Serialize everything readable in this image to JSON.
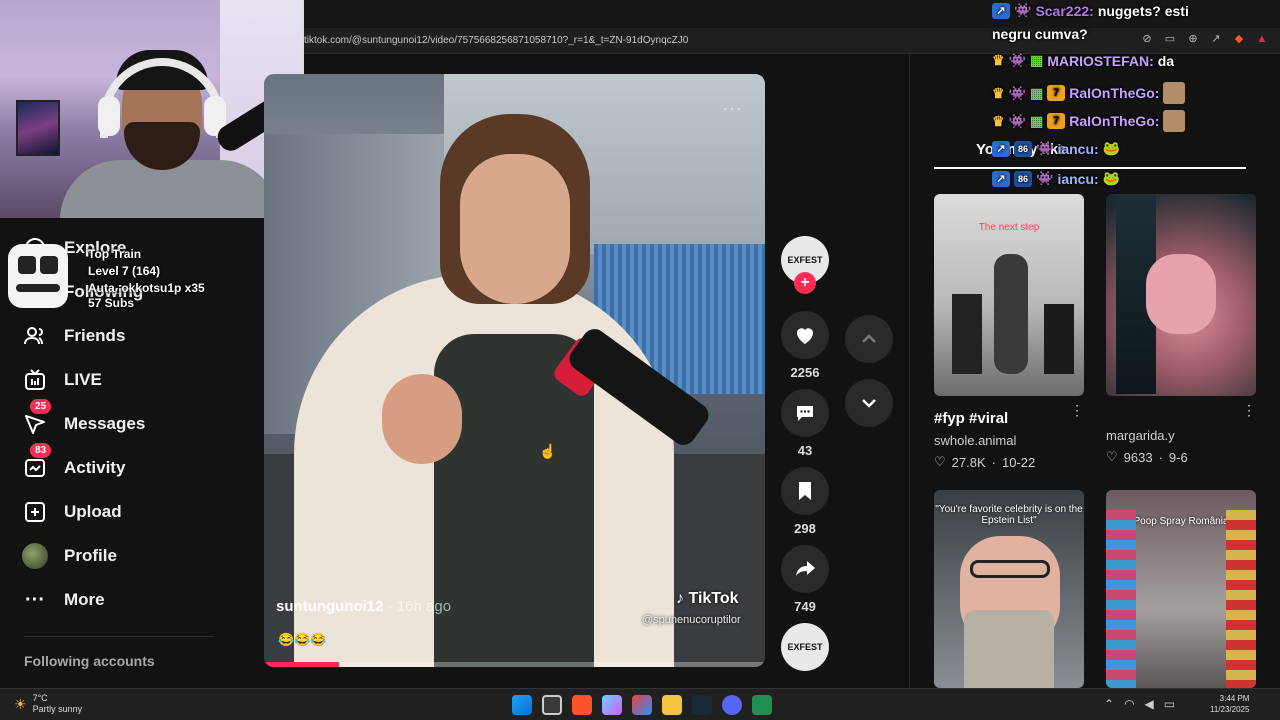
{
  "browser": {
    "url": "tiktok.com/@suntungunoi12/video/7575668256871058710?_r=1&_t=ZN-91dOynqcZJ0"
  },
  "stream_overlay": {
    "train_title": "Top Train",
    "train_level": "Level 7  (164)",
    "train_user": "Auta_okkotsu1p x35",
    "train_subs": "57 Subs"
  },
  "nav": {
    "items": [
      {
        "label": "Explore",
        "icon": "compass-icon"
      },
      {
        "label": "Following",
        "icon": "following-icon"
      },
      {
        "label": "Friends",
        "icon": "friends-icon"
      },
      {
        "label": "LIVE",
        "icon": "live-icon"
      },
      {
        "label": "Messages",
        "icon": "messages-icon",
        "badge": "25"
      },
      {
        "label": "Activity",
        "icon": "activity-icon",
        "badge": "83"
      },
      {
        "label": "Upload",
        "icon": "upload-icon"
      },
      {
        "label": "Profile",
        "icon": "profile-avatar"
      },
      {
        "label": "More",
        "icon": "more-icon"
      }
    ],
    "following_accounts": "Following accounts"
  },
  "video": {
    "author": "suntungunoi12",
    "time": " · 16h ago",
    "caption_emoji": "😂😂😂",
    "watermark": "TikTok",
    "watermark_handle": "@spunenucoruptilor",
    "progress": 0.15,
    "avatar_text": "EXFEST",
    "likes": "2256",
    "comments": "43",
    "saves": "298",
    "shares": "749"
  },
  "right_panel": {
    "title": "You may like",
    "cards": [
      {
        "thumb_caption": "The next step",
        "title": "#fyp #viral",
        "user": "swhole.animal",
        "likes": "27.8K",
        "date": "10-22"
      },
      {
        "thumb_caption": "",
        "title": "",
        "user": "margarida.y",
        "likes": "9633",
        "date": "9-6"
      },
      {
        "thumb_caption": "\"You're favorite celebrity is on the Epstein List\"",
        "title": "",
        "user": "",
        "likes": "",
        "date": ""
      },
      {
        "thumb_caption": "Poop Spray România",
        "title": "",
        "user": "",
        "likes": "",
        "date": ""
      }
    ]
  },
  "chat": [
    {
      "name": "Scar222:",
      "message": "nuggets? esti"
    },
    {
      "name": "",
      "message": "negru cumva?"
    },
    {
      "name": "MARIOSTEFAN:",
      "message": "da"
    },
    {
      "name": "RaIOnTheGo:",
      "message": ""
    },
    {
      "name": "RaIOnTheGo:",
      "message": ""
    },
    {
      "name": "iancu:",
      "message": ""
    },
    {
      "name": "iancu:",
      "message": ""
    }
  ],
  "taskbar": {
    "temp": "7°C",
    "weather": "Partly sunny",
    "time": "3:44 PM",
    "date": "11/23/2025",
    "notification_count": "1"
  },
  "colors": {
    "accent": "#fe2c55",
    "background": "#121212"
  }
}
